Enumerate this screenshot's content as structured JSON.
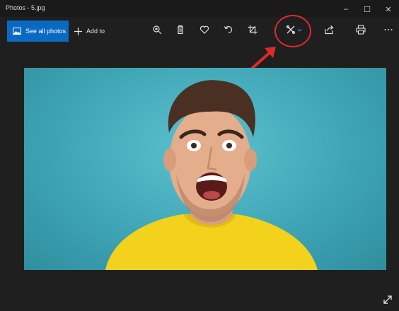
{
  "window": {
    "title": "Photos - 5.jpg",
    "controls": {
      "minimize": "–",
      "maximize": "☐",
      "close": "✕"
    }
  },
  "toolbar": {
    "see_all_photos_label": "See all photos",
    "add_to_label": "Add to",
    "tools": [
      {
        "name": "zoom-in",
        "icon": "zoom-in-icon"
      },
      {
        "name": "delete",
        "icon": "trash-icon"
      },
      {
        "name": "favorite",
        "icon": "heart-icon"
      },
      {
        "name": "rotate",
        "icon": "rotate-icon"
      },
      {
        "name": "crop",
        "icon": "crop-icon"
      },
      {
        "name": "edit-create",
        "icon": "edit-tools-icon"
      },
      {
        "name": "share",
        "icon": "share-icon"
      },
      {
        "name": "print",
        "icon": "print-icon"
      },
      {
        "name": "more",
        "icon": "more-icon"
      }
    ],
    "accent_color": "#0a6ac2"
  },
  "annotation": {
    "highlight_color": "#e02a2a"
  },
  "photo": {
    "subject": "man with surprised expression in yellow t-shirt",
    "background_color": "#4fb6c4",
    "shirt_color": "#f2d21d"
  }
}
